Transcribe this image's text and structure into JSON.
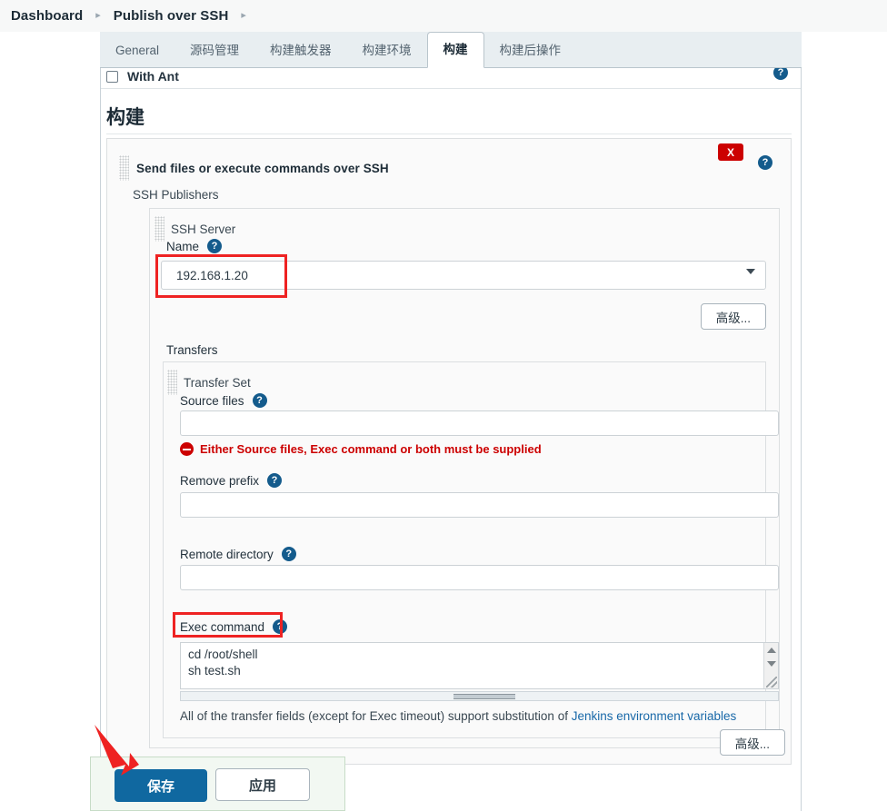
{
  "breadcrumb": {
    "items": [
      "Dashboard",
      "Publish over SSH"
    ],
    "separator": "▸"
  },
  "tabs": [
    {
      "label": "General",
      "active": false
    },
    {
      "label": "源码管理",
      "active": false
    },
    {
      "label": "构建触发器",
      "active": false
    },
    {
      "label": "构建环境",
      "active": false
    },
    {
      "label": "构建",
      "active": true
    },
    {
      "label": "构建后操作",
      "active": false
    }
  ],
  "top_partial": {
    "with_ant_label": "With Ant"
  },
  "section": {
    "heading": "构建"
  },
  "builder": {
    "title": "Send files or execute commands over SSH",
    "close_label": "X",
    "help_label": "?",
    "publishers_label": "SSH Publishers"
  },
  "ssh_server": {
    "title": "SSH Server",
    "name_label": "Name",
    "name_value": "192.168.1.20",
    "name_options": [
      "192.168.1.20"
    ],
    "advanced_label": "高级...",
    "transfers_label": "Transfers"
  },
  "transfer_set": {
    "title": "Transfer Set",
    "source_files_label": "Source files",
    "source_files_value": "",
    "error_message": "Either Source files, Exec command or both must be supplied",
    "remove_prefix_label": "Remove prefix",
    "remove_prefix_value": "",
    "remote_directory_label": "Remote directory",
    "remote_directory_value": "",
    "exec_command_label": "Exec command",
    "exec_command_value": "cd /root/shell\nsh test.sh",
    "note_prefix": "All of the transfer fields (except for Exec timeout) support substitution of ",
    "note_link": "Jenkins environment variables",
    "advanced_label": "高级..."
  },
  "actions": {
    "save_label": "保存",
    "apply_label": "应用"
  },
  "colors": {
    "accent_blue": "#1068a0",
    "help_blue": "#145b8c",
    "danger_red": "#cc0000",
    "annotation_red": "#ee2222",
    "link_blue": "#1868a8",
    "tab_bg": "#e8eef1",
    "panel_bg": "#fafafa"
  }
}
